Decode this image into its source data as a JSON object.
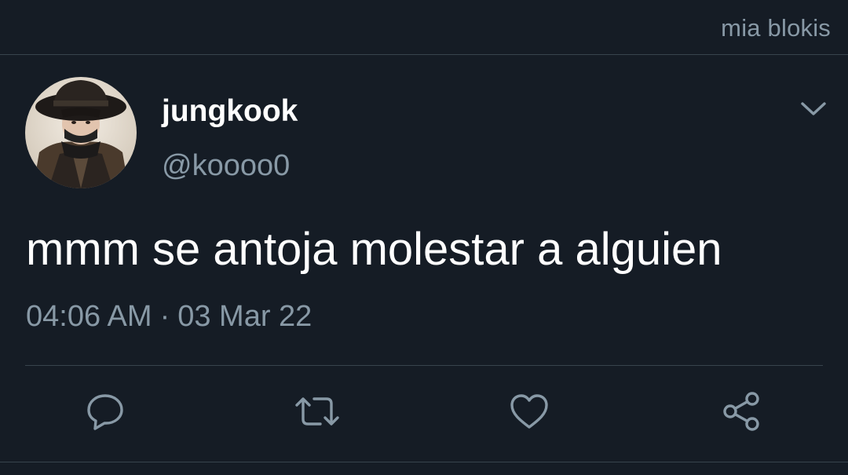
{
  "watermark": "mia blokis",
  "tweet": {
    "display_name": "jungkook",
    "handle": "@koooo0",
    "text": "mmm se antoja molestar a alguien",
    "time": "04:06 AM",
    "separator": "·",
    "date": "03 Mar 22"
  },
  "icons": {
    "menu": "chevron-down-icon",
    "reply": "reply-icon",
    "retweet": "retweet-icon",
    "like": "heart-icon",
    "share": "share-icon"
  },
  "colors": {
    "background": "#151c25",
    "text_primary": "#ffffff",
    "text_secondary": "#8899a6",
    "divider": "#38444d"
  }
}
